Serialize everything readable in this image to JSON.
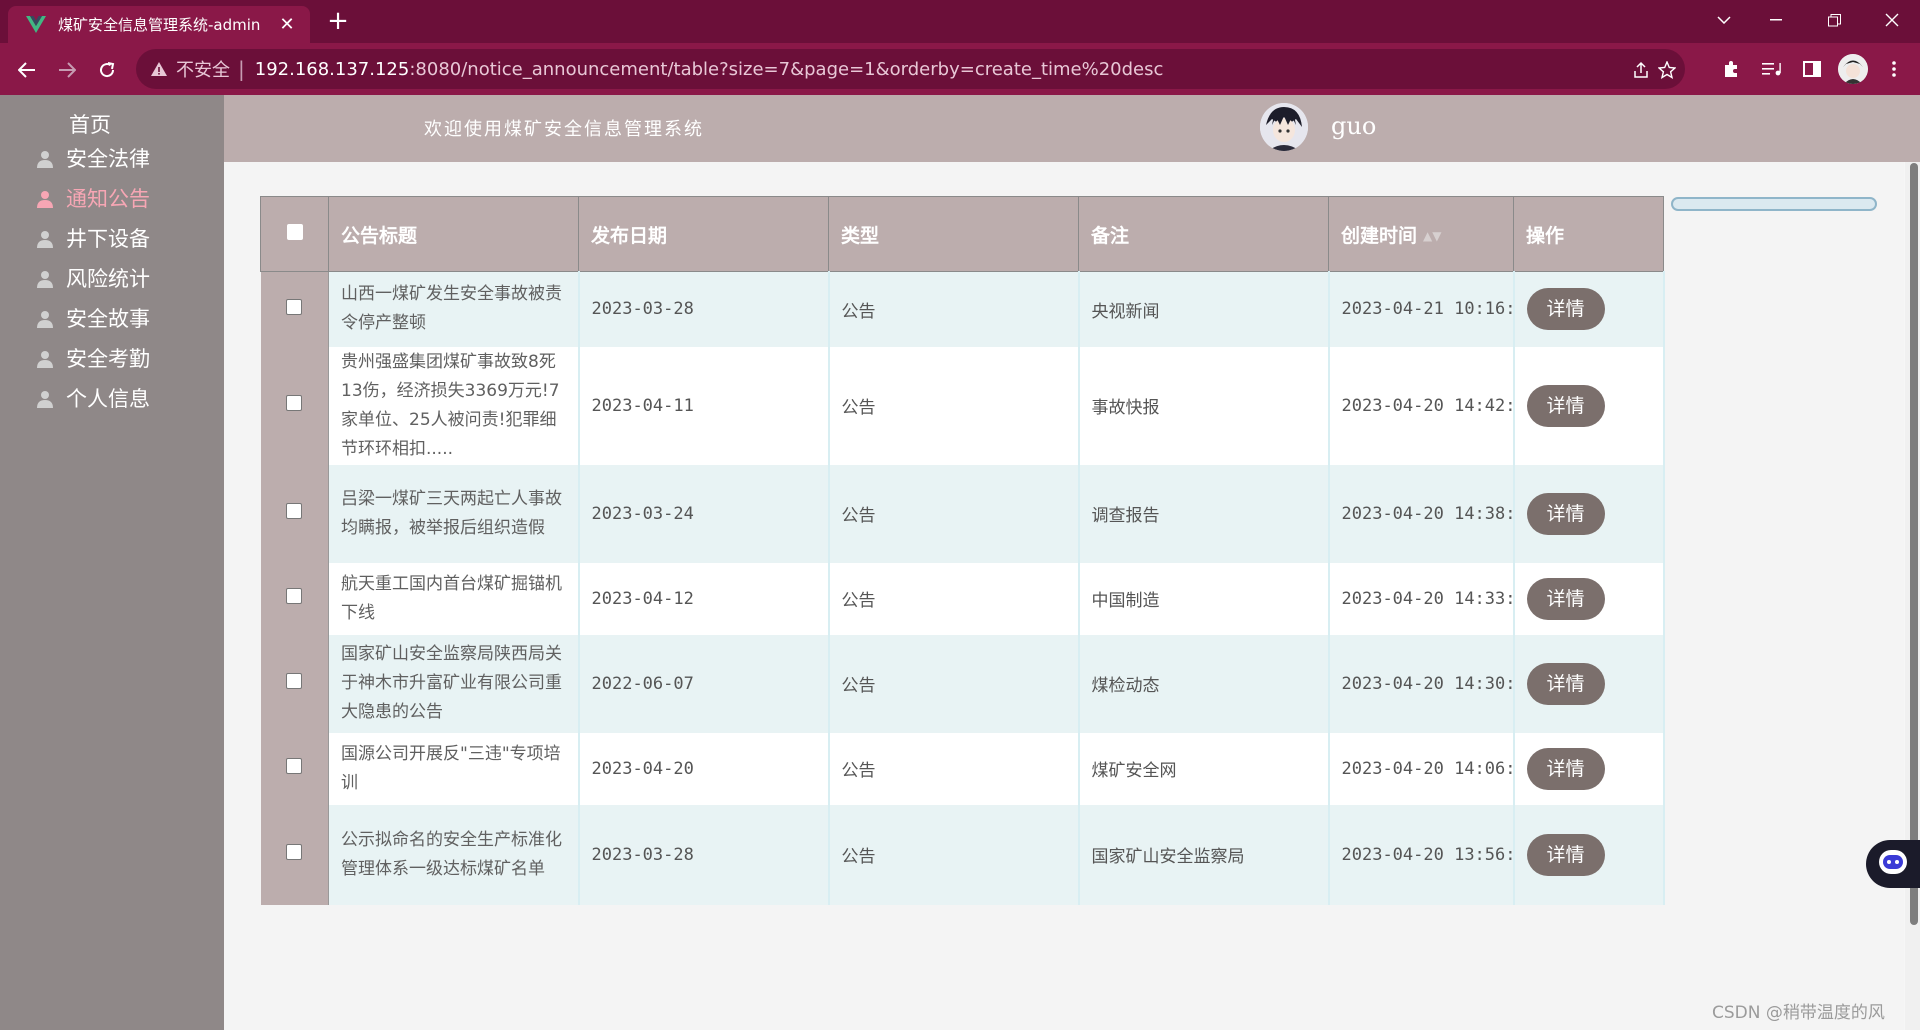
{
  "browser": {
    "tab_title": "煤矿安全信息管理系统-admin",
    "tab_close": "✕",
    "new_tab": "+",
    "insecure_label": "不安全",
    "separator": "|",
    "url_host": "192.168.137.125",
    "url_path": ":8080/notice_announcement/table?size=7&page=1&orderby=create_time%20desc"
  },
  "sidebar": {
    "home": "首页",
    "items": [
      {
        "label": "安全法律",
        "active": false
      },
      {
        "label": "通知公告",
        "active": true
      },
      {
        "label": "井下设备",
        "active": false
      },
      {
        "label": "风险统计",
        "active": false
      },
      {
        "label": "安全故事",
        "active": false
      },
      {
        "label": "安全考勤",
        "active": false
      },
      {
        "label": "个人信息",
        "active": false
      }
    ]
  },
  "header": {
    "welcome": "欢迎使用煤矿安全信息管理系统",
    "username": "guo"
  },
  "table": {
    "columns": [
      "公告标题",
      "发布日期",
      "类型",
      "备注",
      "创建时间",
      "操作"
    ],
    "detail_label": "详情",
    "rows": [
      {
        "title": "山西一煤矿发生安全事故被责令停产整顿",
        "date": "2023-03-28",
        "type": "公告",
        "note": "央视新闻",
        "created": "2023-04-21 10:16:"
      },
      {
        "title": "贵州强盛集团煤矿事故致8死13伤，经济损失3369万元!7家单位、25人被问责!犯罪细节环环相扣.....",
        "date": "2023-04-11",
        "type": "公告",
        "note": "事故快报",
        "created": "2023-04-20 14:42:"
      },
      {
        "title": "吕梁一煤矿三天两起亡人事故均瞒报，被举报后组织造假",
        "date": "2023-03-24",
        "type": "公告",
        "note": "调查报告",
        "created": "2023-04-20 14:38:"
      },
      {
        "title": "航天重工国内首台煤矿掘锚机下线",
        "date": "2023-04-12",
        "type": "公告",
        "note": "中国制造",
        "created": "2023-04-20 14:33:"
      },
      {
        "title": "国家矿山安全监察局陕西局关于神木市升富矿业有限公司重大隐患的公告",
        "date": "2022-06-07",
        "type": "公告",
        "note": "煤检动态",
        "created": "2023-04-20 14:30:"
      },
      {
        "title": "国源公司开展反\"三违\"专项培训",
        "date": "2023-04-20",
        "type": "公告",
        "note": "煤矿安全网",
        "created": "2023-04-20 14:06:"
      },
      {
        "title": "公示拟命名的安全生产标准化管理体系一级达标煤矿名单",
        "date": "2023-03-28",
        "type": "公告",
        "note": "国家矿山安全监察局",
        "created": "2023-04-20 13:56:"
      }
    ]
  },
  "watermark": "CSDN @稍带温度的风",
  "colors": {
    "chrome_dark": "#6b0f39",
    "chrome": "#8a1848",
    "sidebar": "#8f8888",
    "header": "#bcadad",
    "active_menu": "#f7a6b4",
    "button": "#7b6f6c"
  }
}
